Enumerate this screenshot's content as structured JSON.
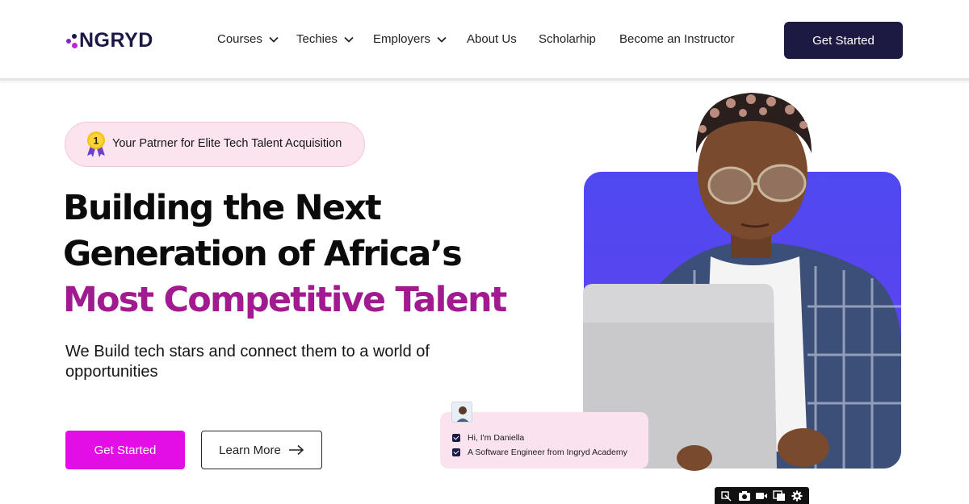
{
  "brand": {
    "logo_text": "NGRYD"
  },
  "nav": {
    "items": [
      {
        "label": "Courses",
        "dropdown": true
      },
      {
        "label": "Techies",
        "dropdown": true
      },
      {
        "label": "Employers",
        "dropdown": true
      },
      {
        "label": "About Us",
        "dropdown": false
      },
      {
        "label": "Scholarhip",
        "dropdown": false
      },
      {
        "label": "Become an Instructor",
        "dropdown": false
      }
    ],
    "cta_label": "Get Started"
  },
  "hero": {
    "badge_icon": "medal-icon",
    "badge_number": "1",
    "badge_text": "Your Patrner for Elite Tech Talent Acquisition",
    "headline_line1": "Building the Next",
    "headline_line2": "Generation of Africa’s",
    "headline_line3": "Most Competitive Talent",
    "subtext": "We Build tech stars and connect them to a world of opportunities",
    "primary_button": "Get Started",
    "secondary_button": "Learn More"
  },
  "profile_card": {
    "line1": "Hi, I'm Daniella",
    "line2": "A Software Engineer from Ingryd Academy"
  },
  "media_toolbar": {
    "icons": [
      "screenshot-icon",
      "camera-icon",
      "video-icon",
      "window-icon",
      "gear-icon"
    ]
  },
  "colors": {
    "brand_dark": "#1c1943",
    "accent_magenta": "#a21a8f",
    "button_magenta": "#e20ee5",
    "badge_bg": "#fbe4ee",
    "hero_blue": "#5147ef"
  }
}
